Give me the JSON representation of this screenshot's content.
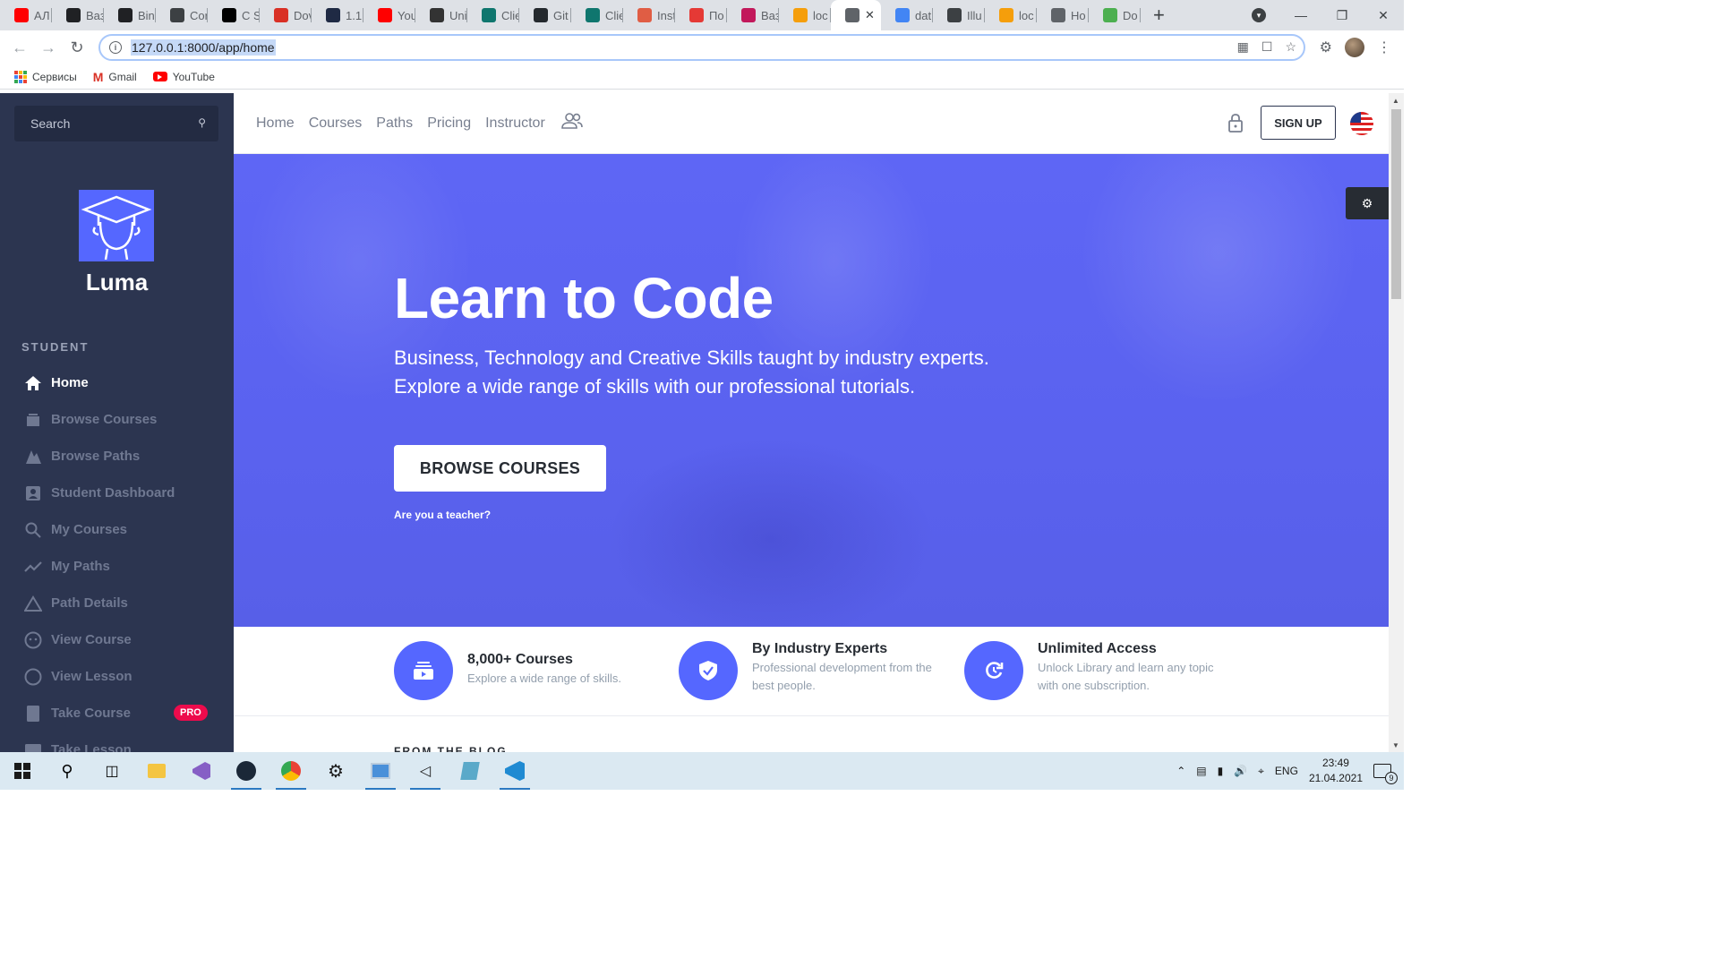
{
  "browser": {
    "tabs": [
      {
        "label": "АЛ",
        "color": "#ff0000"
      },
      {
        "label": "Ваз",
        "color": "#202124"
      },
      {
        "label": "Bin",
        "color": "#202124"
      },
      {
        "label": "Cor",
        "color": "#3c4043"
      },
      {
        "label": "C S",
        "color": "#000000"
      },
      {
        "label": "Dov",
        "color": "#d93025"
      },
      {
        "label": "1.1",
        "color": "#1f2a44"
      },
      {
        "label": "You",
        "color": "#ff0000"
      },
      {
        "label": "Uni",
        "color": "#333333"
      },
      {
        "label": "Clie",
        "color": "#0f766e"
      },
      {
        "label": "Git",
        "color": "#24292e"
      },
      {
        "label": "Clie",
        "color": "#0f766e"
      },
      {
        "label": "Inst",
        "color": "#e05d44"
      },
      {
        "label": "По",
        "color": "#e53935"
      },
      {
        "label": "Ваз",
        "color": "#c2185b"
      },
      {
        "label": "loc",
        "color": "#f59e0b"
      },
      {
        "label": "",
        "color": "#5f6368",
        "active": true
      },
      {
        "label": "dat",
        "color": "#4285f4"
      },
      {
        "label": "Illu",
        "color": "#3c4043"
      },
      {
        "label": "loc",
        "color": "#f59e0b"
      },
      {
        "label": "Ho",
        "color": "#5f6368"
      },
      {
        "label": "Do",
        "color": "#4caf50"
      }
    ],
    "url": "127.0.0.1:8000/app/home",
    "bookmarks": {
      "apps": "Сервисы",
      "gmail": "Gmail",
      "youtube": "YouTube"
    }
  },
  "sidebar": {
    "search_placeholder": "Search",
    "brand": "Luma",
    "section": "STUDENT",
    "items": [
      {
        "label": "Home",
        "icon": "home-icon",
        "active": true
      },
      {
        "label": "Browse Courses",
        "icon": "courses-icon"
      },
      {
        "label": "Browse Paths",
        "icon": "paths-icon"
      },
      {
        "label": "Student Dashboard",
        "icon": "dashboard-icon"
      },
      {
        "label": "My Courses",
        "icon": "search-icon"
      },
      {
        "label": "My Paths",
        "icon": "trending-icon"
      },
      {
        "label": "Path Details",
        "icon": "triangle-icon"
      },
      {
        "label": "View Course",
        "icon": "face-icon"
      },
      {
        "label": "View Lesson",
        "icon": "circle-icon"
      },
      {
        "label": "Take Course",
        "icon": "book-icon",
        "badge": "PRO"
      },
      {
        "label": "Take Lesson",
        "icon": "lesson-icon"
      }
    ]
  },
  "topnav": {
    "links": [
      "Home",
      "Courses",
      "Paths",
      "Pricing",
      "Instructor"
    ],
    "signup": "SIGN UP"
  },
  "hero": {
    "title": "Learn to Code",
    "lead_line1": "Business, Technology and Creative Skills taught by industry experts.",
    "lead_line2": "Explore a wide range of skills with our professional tutorials.",
    "cta": "BROWSE COURSES",
    "teacher_link": "Are you a teacher?"
  },
  "features": [
    {
      "title": "8,000+ Courses",
      "desc": "Explore a wide range of skills.",
      "icon": "video-library-icon"
    },
    {
      "title": "By Industry Experts",
      "desc": "Professional development from the best people.",
      "icon": "verified-icon"
    },
    {
      "title": "Unlimited Access",
      "desc": "Unlock Library and learn any topic with one subscription.",
      "icon": "update-icon"
    }
  ],
  "blog_peek": "FROM THE BLOG",
  "taskbar": {
    "lang": "ENG",
    "time": "23:49",
    "date": "21.04.2021",
    "notifications": "9"
  },
  "colors": {
    "primary": "#5567ff",
    "sidebar": "#2c3550",
    "pro_badge": "#ed0b4c"
  }
}
